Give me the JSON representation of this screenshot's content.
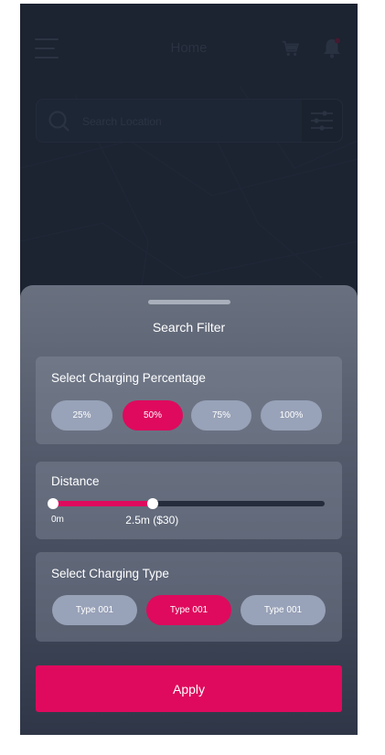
{
  "header": {
    "title": "Home",
    "menu_icon": "menu-icon",
    "cart_icon": "cart-icon",
    "bell_icon": "bell-icon"
  },
  "search": {
    "placeholder": "Search Location",
    "value": "",
    "search_icon": "search-icon",
    "filter_icon": "filter-sliders-icon"
  },
  "filter": {
    "title": "Search Filter",
    "percentage": {
      "label": "Select Charging Percentage",
      "options": [
        "25%",
        "50%",
        "75%",
        "100%"
      ],
      "selected": "50%"
    },
    "distance": {
      "label": "Distance",
      "min_label": "0m",
      "value_label": "2.5m ($30)",
      "value_fraction": 0.37
    },
    "charging_type": {
      "label": "Select Charging Type",
      "options": [
        "Type 001",
        "Type 001",
        "Type 001"
      ],
      "selected_index": 1
    },
    "apply_label": "Apply"
  },
  "colors": {
    "accent": "#df0a5d",
    "background": "#232b3b",
    "pill_inactive": "#98a2b8"
  }
}
